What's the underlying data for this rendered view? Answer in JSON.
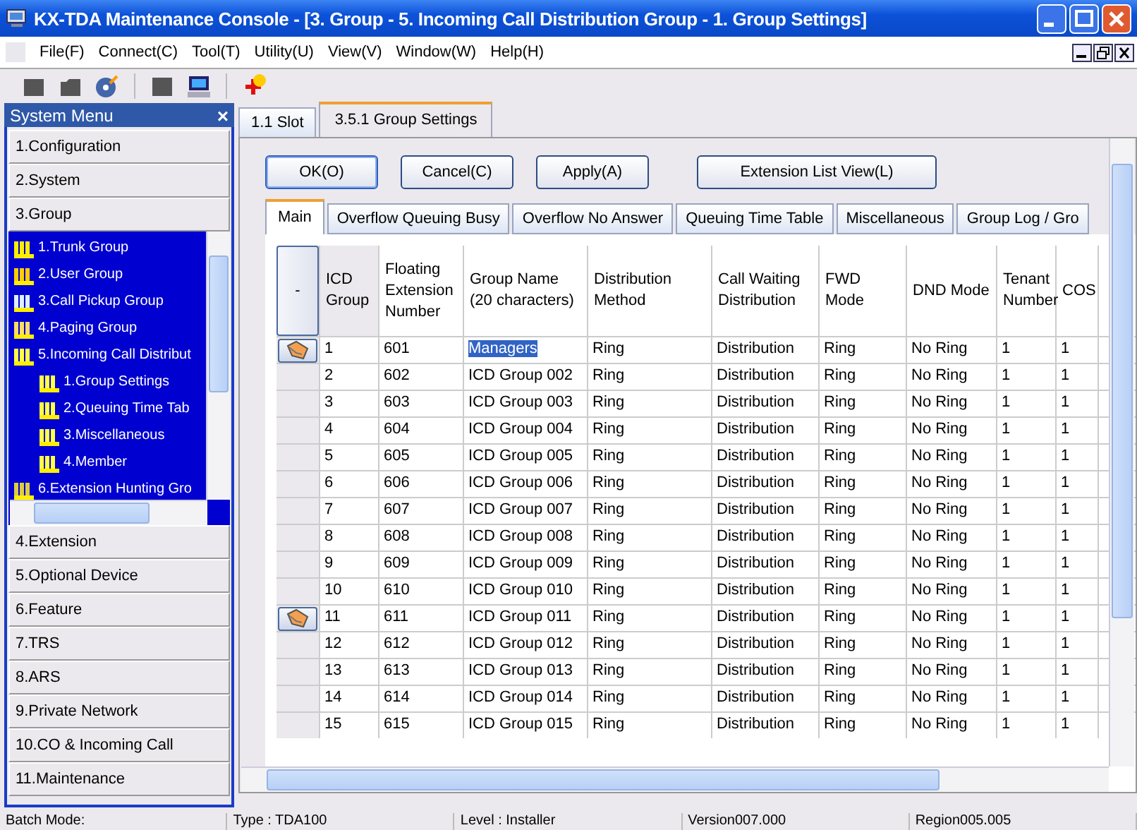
{
  "window": {
    "title": "KX-TDA Maintenance Console - [3. Group - 5. Incoming Call Distribution Group - 1. Group Settings]"
  },
  "menu": [
    "File(F)",
    "Connect(C)",
    "Tool(T)",
    "Utility(U)",
    "View(V)",
    "Window(W)",
    "Help(H)"
  ],
  "sidebar": {
    "title": "System Menu",
    "close": "×",
    "sections": [
      {
        "label": "1.Configuration"
      },
      {
        "label": "2.System"
      },
      {
        "label": "3.Group",
        "items": [
          {
            "label": "1.Trunk Group",
            "kind": "trunk"
          },
          {
            "label": "2.User Group",
            "kind": "user"
          },
          {
            "label": "3.Call Pickup Group",
            "kind": "pickup"
          },
          {
            "label": "4.Paging Group",
            "kind": "paging"
          },
          {
            "label": "5.Incoming Call Distribut",
            "kind": "icd",
            "children": [
              {
                "label": "1.Group Settings",
                "kind": "icd"
              },
              {
                "label": "2.Queuing Time Tab",
                "kind": "icd"
              },
              {
                "label": "3.Miscellaneous",
                "kind": "icd"
              },
              {
                "label": "4.Member",
                "kind": "icd"
              }
            ]
          },
          {
            "label": "6.Extension Hunting Gro",
            "kind": "hunting"
          }
        ]
      },
      {
        "label": "4.Extension"
      },
      {
        "label": "5.Optional Device"
      },
      {
        "label": "6.Feature"
      },
      {
        "label": "7.TRS"
      },
      {
        "label": "8.ARS"
      },
      {
        "label": "9.Private Network"
      },
      {
        "label": "10.CO & Incoming Call"
      },
      {
        "label": "11.Maintenance"
      }
    ]
  },
  "doc_tabs": [
    {
      "label": "1.1 Slot",
      "selected": false
    },
    {
      "label": "3.5.1 Group Settings",
      "selected": true
    }
  ],
  "buttons": [
    {
      "label": "OK(O)",
      "default": true
    },
    {
      "label": "Cancel(C)",
      "default": false
    },
    {
      "label": "Apply(A)",
      "default": false
    },
    {
      "label": "Extension List View(L)",
      "default": false
    }
  ],
  "tabs": [
    {
      "label": "Main",
      "selected": true
    },
    {
      "label": "Overflow Queuing Busy",
      "selected": false
    },
    {
      "label": "Overflow No Answer",
      "selected": false
    },
    {
      "label": "Queuing Time Table",
      "selected": false
    },
    {
      "label": "Miscellaneous",
      "selected": false
    },
    {
      "label": "Group Log / Gro",
      "selected": false
    }
  ],
  "table": {
    "corner": "-",
    "columns": [
      "ICD Group",
      "Floating Extension Number",
      "Group Name (20 characters)",
      "Distribution Method",
      "Call Waiting Distribution",
      "FWD Mode",
      "DND Mode",
      "Tenant Number",
      "COS"
    ],
    "rows": [
      {
        "marked": true,
        "selected": true,
        "cells": [
          "1",
          "601",
          "Managers",
          "Ring",
          "Distribution",
          "Ring",
          "No Ring",
          "1",
          "1"
        ]
      },
      {
        "marked": false,
        "selected": false,
        "cells": [
          "2",
          "602",
          "ICD Group 002",
          "Ring",
          "Distribution",
          "Ring",
          "No Ring",
          "1",
          "1"
        ]
      },
      {
        "marked": false,
        "selected": false,
        "cells": [
          "3",
          "603",
          "ICD Group 003",
          "Ring",
          "Distribution",
          "Ring",
          "No Ring",
          "1",
          "1"
        ]
      },
      {
        "marked": false,
        "selected": false,
        "cells": [
          "4",
          "604",
          "ICD Group 004",
          "Ring",
          "Distribution",
          "Ring",
          "No Ring",
          "1",
          "1"
        ]
      },
      {
        "marked": false,
        "selected": false,
        "cells": [
          "5",
          "605",
          "ICD Group 005",
          "Ring",
          "Distribution",
          "Ring",
          "No Ring",
          "1",
          "1"
        ]
      },
      {
        "marked": false,
        "selected": false,
        "cells": [
          "6",
          "606",
          "ICD Group 006",
          "Ring",
          "Distribution",
          "Ring",
          "No Ring",
          "1",
          "1"
        ]
      },
      {
        "marked": false,
        "selected": false,
        "cells": [
          "7",
          "607",
          "ICD Group 007",
          "Ring",
          "Distribution",
          "Ring",
          "No Ring",
          "1",
          "1"
        ]
      },
      {
        "marked": false,
        "selected": false,
        "cells": [
          "8",
          "608",
          "ICD Group 008",
          "Ring",
          "Distribution",
          "Ring",
          "No Ring",
          "1",
          "1"
        ]
      },
      {
        "marked": false,
        "selected": false,
        "cells": [
          "9",
          "609",
          "ICD Group 009",
          "Ring",
          "Distribution",
          "Ring",
          "No Ring",
          "1",
          "1"
        ]
      },
      {
        "marked": false,
        "selected": false,
        "cells": [
          "10",
          "610",
          "ICD Group 010",
          "Ring",
          "Distribution",
          "Ring",
          "No Ring",
          "1",
          "1"
        ]
      },
      {
        "marked": true,
        "selected": false,
        "cells": [
          "11",
          "611",
          "ICD Group 011",
          "Ring",
          "Distribution",
          "Ring",
          "No Ring",
          "1",
          "1"
        ]
      },
      {
        "marked": false,
        "selected": false,
        "cells": [
          "12",
          "612",
          "ICD Group 012",
          "Ring",
          "Distribution",
          "Ring",
          "No Ring",
          "1",
          "1"
        ]
      },
      {
        "marked": false,
        "selected": false,
        "cells": [
          "13",
          "613",
          "ICD Group 013",
          "Ring",
          "Distribution",
          "Ring",
          "No Ring",
          "1",
          "1"
        ]
      },
      {
        "marked": false,
        "selected": false,
        "cells": [
          "14",
          "614",
          "ICD Group 014",
          "Ring",
          "Distribution",
          "Ring",
          "No Ring",
          "1",
          "1"
        ]
      },
      {
        "marked": false,
        "selected": false,
        "cells": [
          "15",
          "615",
          "ICD Group 015",
          "Ring",
          "Distribution",
          "Ring",
          "No Ring",
          "1",
          "1"
        ]
      }
    ]
  },
  "status_bar": [
    "Batch Mode:",
    "Type : TDA100",
    "Level : Installer",
    "Version007.000",
    "Region005.005"
  ]
}
